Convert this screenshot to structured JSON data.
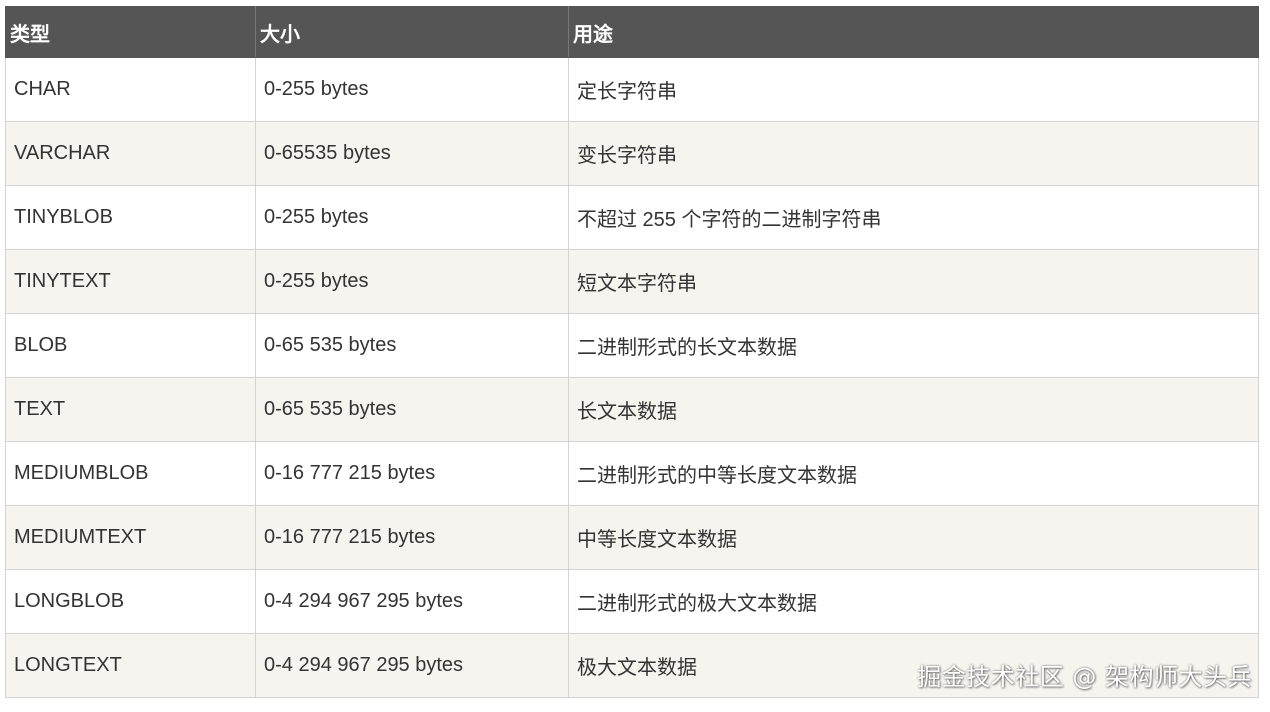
{
  "table": {
    "headers": [
      "类型",
      "大小",
      "用途"
    ],
    "rows": [
      {
        "type": "CHAR",
        "size": "0-255 bytes",
        "usage": "定长字符串"
      },
      {
        "type": "VARCHAR",
        "size": "0-65535 bytes",
        "usage": "变长字符串"
      },
      {
        "type": "TINYBLOB",
        "size": "0-255 bytes",
        "usage": "不超过 255 个字符的二进制字符串"
      },
      {
        "type": "TINYTEXT",
        "size": "0-255 bytes",
        "usage": "短文本字符串"
      },
      {
        "type": "BLOB",
        "size": "0-65 535 bytes",
        "usage": "二进制形式的长文本数据"
      },
      {
        "type": "TEXT",
        "size": "0-65 535 bytes",
        "usage": "长文本数据"
      },
      {
        "type": "MEDIUMBLOB",
        "size": "0-16 777 215 bytes",
        "usage": "二进制形式的中等长度文本数据"
      },
      {
        "type": "MEDIUMTEXT",
        "size": "0-16 777 215 bytes",
        "usage": "中等长度文本数据"
      },
      {
        "type": "LONGBLOB",
        "size": "0-4 294 967 295 bytes",
        "usage": "二进制形式的极大文本数据"
      },
      {
        "type": "LONGTEXT",
        "size": "0-4 294 967 295 bytes",
        "usage": "极大文本数据"
      }
    ]
  },
  "watermark": "掘金技术社区 @ 架构师大头兵",
  "colors": {
    "header_bg": "#555555",
    "header_text": "#ffffff",
    "row_alt_bg": "#f5f4ef",
    "border": "#d4d4d4",
    "text": "#333333"
  }
}
